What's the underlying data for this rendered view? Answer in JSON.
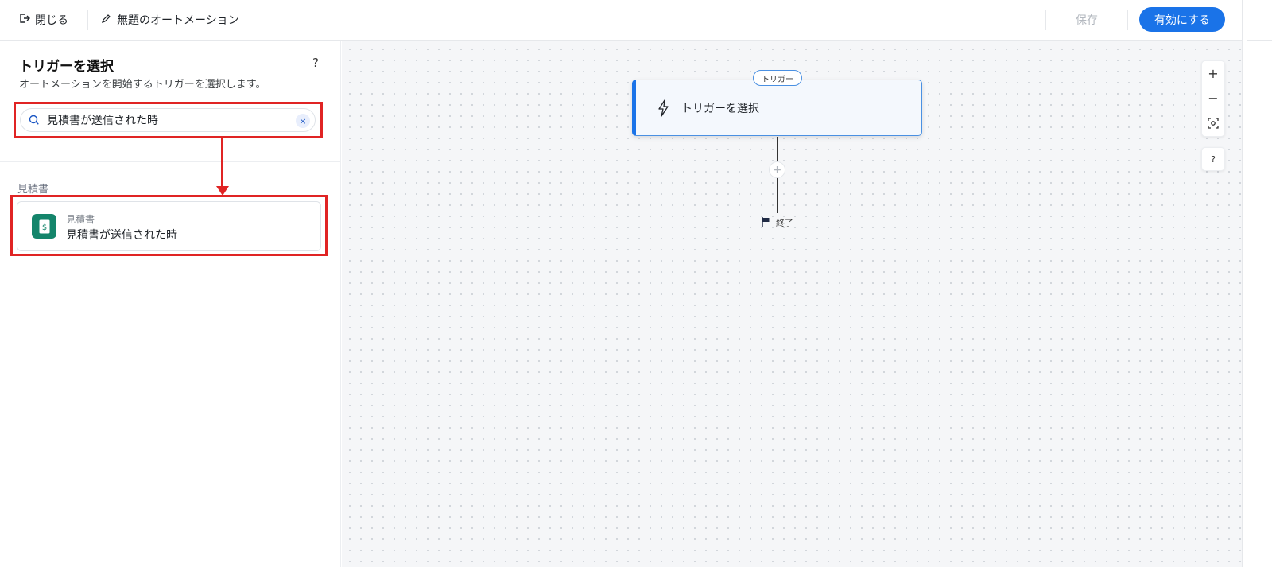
{
  "topbar": {
    "close_label": "閉じる",
    "close_icon": "exit-icon",
    "title": "無題のオートメーション",
    "edit_icon": "pencil-icon",
    "save_label": "保存",
    "enable_label": "有効にする"
  },
  "panel": {
    "title": "トリガーを選択",
    "help": "?",
    "description": "オートメーションを開始するトリガーを選択します。",
    "search": {
      "value": "見積書が送信された時",
      "icon": "search-icon",
      "clear_icon": "close-icon",
      "clear_glyph": "×"
    },
    "category_label": "見積書",
    "result": {
      "icon": "estimate-document-icon",
      "category": "見積書",
      "label": "見積書が送信された時"
    }
  },
  "canvas": {
    "trigger_tag": "トリガー",
    "trigger_node_label": "トリガーを選択",
    "trigger_icon": "lightning-icon",
    "add_step": "+",
    "end_label": "終了",
    "end_icon": "flag-icon",
    "zoom_in": "+",
    "zoom_out": "−",
    "help": "?"
  },
  "colors": {
    "accent": "#1a73e8",
    "highlight": "#e02424",
    "estimate_icon_bg": "#14856b"
  }
}
